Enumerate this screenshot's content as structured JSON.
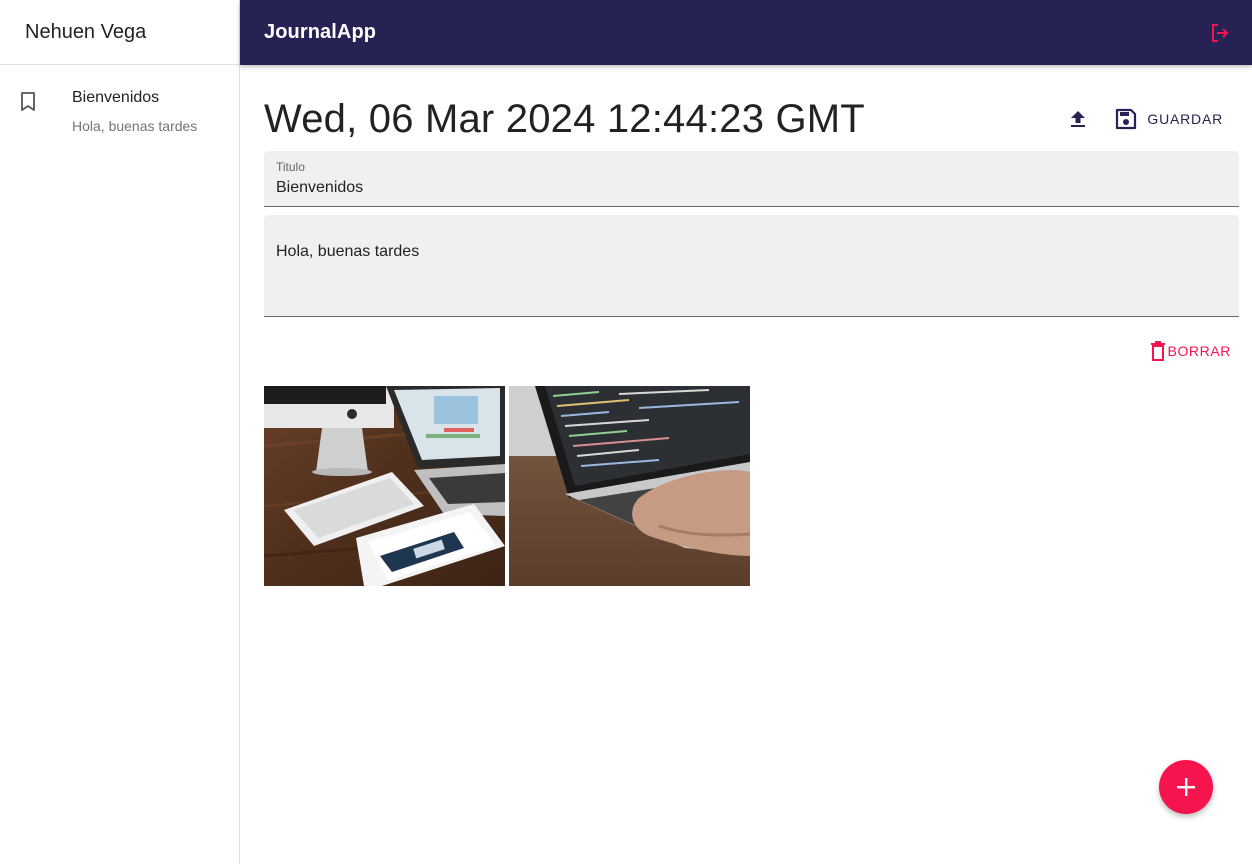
{
  "sidebar": {
    "user_name": "Nehuen Vega",
    "notes": [
      {
        "title": "Bienvenidos",
        "body": "Hola, buenas tardes",
        "icon": "bookmark-icon"
      }
    ]
  },
  "appbar": {
    "title": "JournalApp",
    "logout_icon": "logout-icon"
  },
  "note": {
    "date": "Wed, 06 Mar 2024 12:44:23 GMT",
    "title_label": "Titulo",
    "title_value": "Bienvenidos",
    "body_value": "Hola, buenas tardes",
    "save_label": "GUARDAR",
    "delete_label": "BORRAR",
    "images": [
      {
        "name": "desk-devices-photo"
      },
      {
        "name": "laptop-coding-photo"
      }
    ]
  },
  "colors": {
    "primary": "#262254",
    "accent": "#f5144e",
    "field_bg": "#f0f0f0"
  }
}
